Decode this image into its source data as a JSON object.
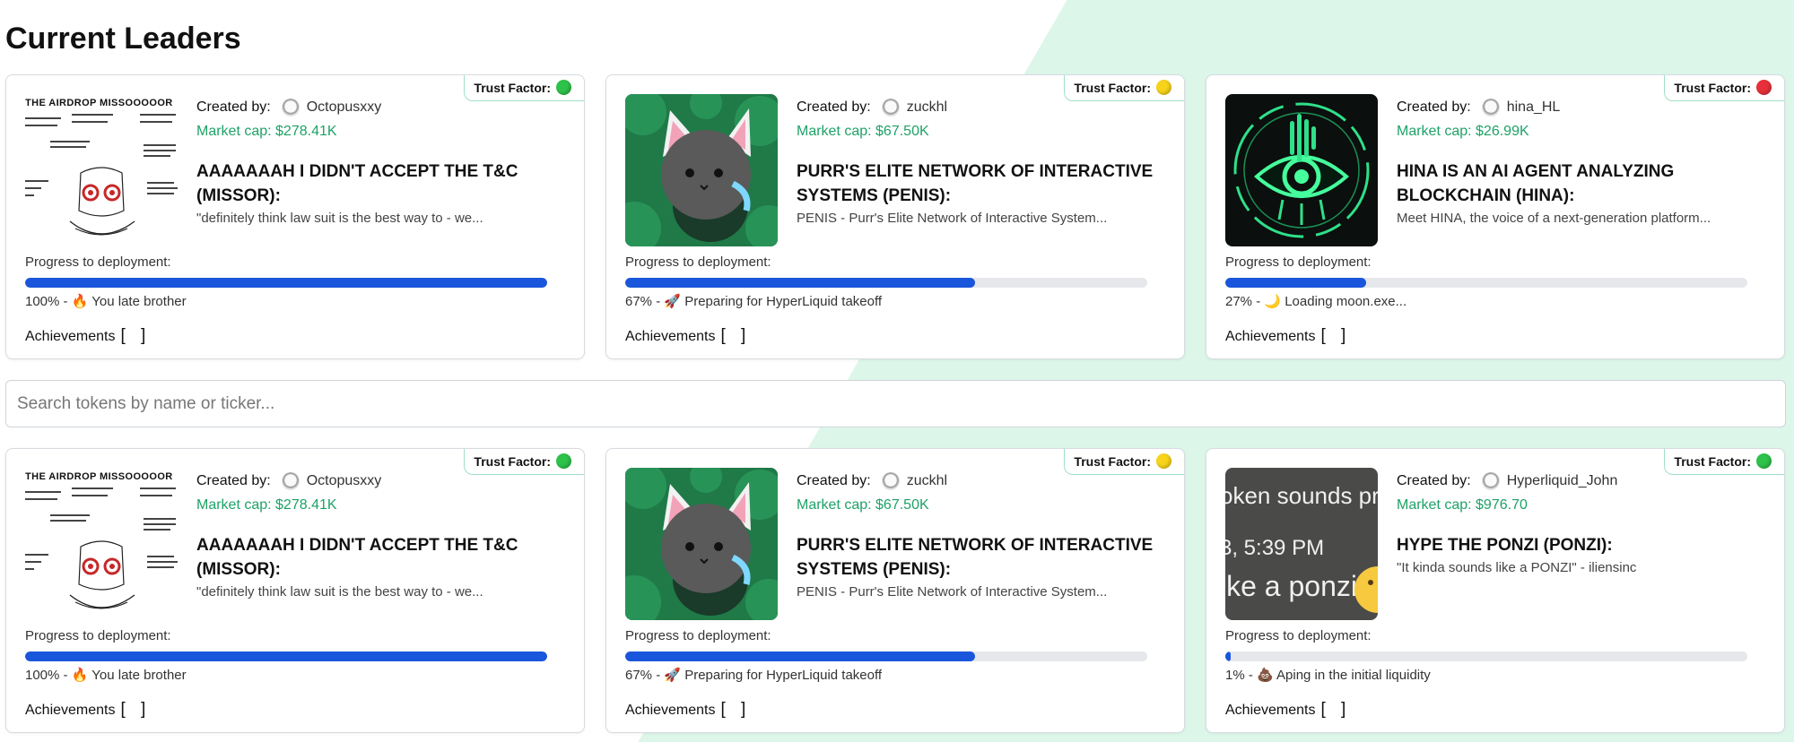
{
  "page": {
    "title": "Current Leaders"
  },
  "search": {
    "placeholder": "Search tokens by name or ticker..."
  },
  "leaders": [
    {
      "trust_label": "Trust Factor:",
      "trust_color": "#2ec24a",
      "thumb": "airdrop-meme",
      "thumb_text": "THE AIRDROP MISSOOOOOR",
      "created_label": "Created by:",
      "creator": "Octopusxxy",
      "market_cap": "Market cap: $278.41K",
      "name": "AAAAAAAH I DIDN'T ACCEPT THE T&C (MISSOR):",
      "description": "\"definitely think law suit is the best way to - we...",
      "progress_label": "Progress to deployment:",
      "progress": 100,
      "status": "100% - 🔥 You late brother",
      "achievements_label": "Achievements",
      "achievements": "[ ]"
    },
    {
      "trust_label": "Trust Factor:",
      "trust_color": "#f7d31a",
      "thumb": "cat-image",
      "created_label": "Created by:",
      "creator": "zuckhl",
      "market_cap": "Market cap: $67.50K",
      "name": "PURR'S ELITE NETWORK OF INTERACTIVE SYSTEMS (PENIS):",
      "description": "PENIS - Purr's Elite Network of Interactive System...",
      "progress_label": "Progress to deployment:",
      "progress": 67,
      "status": "67% - 🚀 Preparing for HyperLiquid takeoff",
      "achievements_label": "Achievements",
      "achievements": "[ ]"
    },
    {
      "trust_label": "Trust Factor:",
      "trust_color": "#e8303a",
      "thumb": "eye-logo",
      "created_label": "Created by:",
      "creator": "hina_HL",
      "market_cap": "Market cap: $26.99K",
      "name": "HINA IS AN AI AGENT ANALYZING BLOCKCHAIN (HINA):",
      "description": "Meet HINA, the voice of a next-generation platform...",
      "progress_label": "Progress to deployment:",
      "progress": 27,
      "status": "27% - 🌙 Loading moon.exe...",
      "achievements_label": "Achievements",
      "achievements": "[ ]"
    }
  ],
  "tokens": [
    {
      "trust_label": "Trust Factor:",
      "trust_color": "#2ec24a",
      "thumb": "airdrop-meme",
      "thumb_text": "THE AIRDROP MISSOOOOOR",
      "created_label": "Created by:",
      "creator": "Octopusxxy",
      "market_cap": "Market cap: $278.41K",
      "name": "AAAAAAAH I DIDN'T ACCEPT THE T&C (MISSOR):",
      "description": "\"definitely think law suit is the best way to - we...",
      "progress_label": "Progress to deployment:",
      "progress": 100,
      "status": "100% - 🔥 You late brother",
      "achievements_label": "Achievements",
      "achievements": "[ ]"
    },
    {
      "trust_label": "Trust Factor:",
      "trust_color": "#f7d31a",
      "thumb": "cat-image",
      "created_label": "Created by:",
      "creator": "zuckhl",
      "market_cap": "Market cap: $67.50K",
      "name": "PURR'S ELITE NETWORK OF INTERACTIVE SYSTEMS (PENIS):",
      "description": "PENIS - Purr's Elite Network of Interactive System...",
      "progress_label": "Progress to deployment:",
      "progress": 67,
      "status": "67% - 🚀 Preparing for HyperLiquid takeoff",
      "achievements_label": "Achievements",
      "achievements": "[ ]"
    },
    {
      "trust_label": "Trust Factor:",
      "trust_color": "#2ec24a",
      "thumb": "ponzi-screenshot",
      "thumb_lines": [
        "oken sounds pr",
        "3, 5:39 PM",
        "ike a ponzi"
      ],
      "created_label": "Created by:",
      "creator": "Hyperliquid_John",
      "market_cap": "Market cap: $976.70",
      "name": "HYPE THE PONZI (PONZI):",
      "description": "\"It kinda sounds like a PONZI\" - iliensinc",
      "progress_label": "Progress to deployment:",
      "progress": 1,
      "status": "1% - 💩 Aping in the initial liquidity",
      "achievements_label": "Achievements",
      "achievements": "[ ]"
    }
  ]
}
